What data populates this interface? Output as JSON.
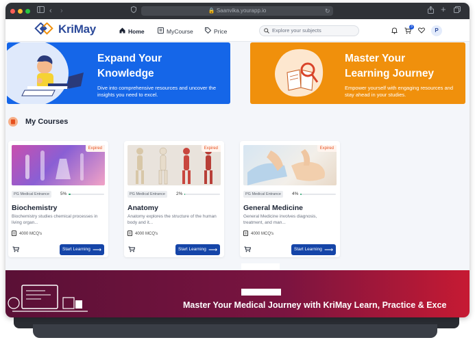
{
  "browser": {
    "url": "Saanvika.yourapp.io",
    "icons": [
      "sidebar-icon",
      "back-icon",
      "forward-icon",
      "shield-icon",
      "reload-icon",
      "share-icon",
      "new-tab-icon",
      "tabs-icon"
    ]
  },
  "header": {
    "brand": "KriMay",
    "nav": [
      {
        "label": "Home",
        "icon": "home-icon",
        "active": true
      },
      {
        "label": "MyCourse",
        "icon": "book-icon",
        "active": false
      },
      {
        "label": "Price",
        "icon": "tag-icon",
        "active": false
      }
    ],
    "search_placeholder": "Explore your subjects",
    "cart_count": "3",
    "avatar_initial": "P"
  },
  "banners": [
    {
      "title_line1": "Expand Your",
      "title_line2": "Knowledge",
      "text": "Dive into comprehensive resources and uncover the insights you need to excel.",
      "color": "#1566e8"
    },
    {
      "title_line1": "Master Your",
      "title_line2": "Learning Journey",
      "text": "Empower yourself with engaging resources and stay ahead in your studies.",
      "color": "#f0900c"
    }
  ],
  "my_courses": {
    "title": "My Courses",
    "courses": [
      {
        "name": "Biochemistry",
        "status": "Expired",
        "category": "PG Medical Entrance",
        "progress_label": "5%",
        "progress": 0.05,
        "description": "Biochemistry studies chemical processes in living organ...",
        "mcq": "4000 MCQ's",
        "cta": "Start Learning"
      },
      {
        "name": "Anatomy",
        "status": "Expired",
        "category": "PG Medical Entrance",
        "progress_label": "2%",
        "progress": 0.02,
        "description": "Anatomy explores the structure of the human body and it...",
        "mcq": "4000 MCQ's",
        "cta": "Start Learning"
      },
      {
        "name": "General Medicine",
        "status": "Expired",
        "category": "PG Medical Entrance",
        "progress_label": "4%",
        "progress": 0.04,
        "description": "General Medicine involves diagnosis, treatment, and man...",
        "mcq": "4000 MCQ's",
        "cta": "Start Learning"
      }
    ]
  },
  "footer": {
    "text": "Master Your Medical Journey with KriMay Learn, Practice & Exce"
  },
  "colors": {
    "primary": "#1545a8",
    "expired": "#e5501f",
    "progress": "#21a366",
    "footer_start": "#5a1036",
    "footer_end": "#c61a33"
  }
}
